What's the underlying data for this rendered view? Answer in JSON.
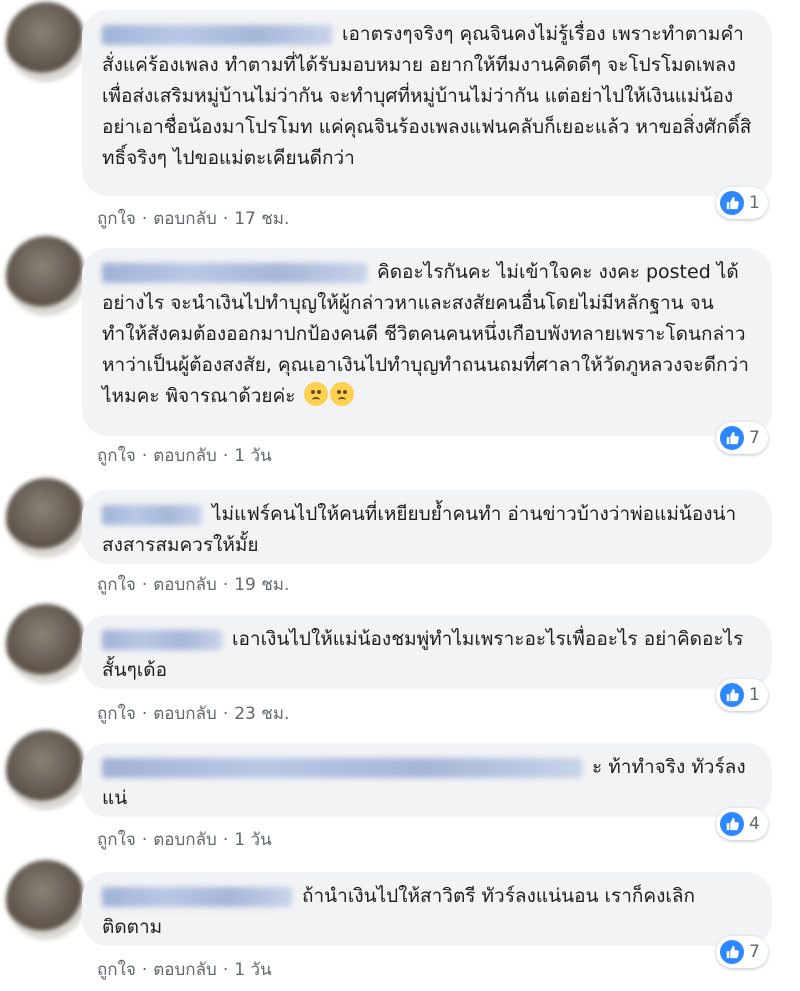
{
  "actions": {
    "like": "ถูกใจ",
    "reply": "ตอบกลับ",
    "sep": "·"
  },
  "comments": [
    {
      "text": "เอาตรงๆจริงๆ คุณจินคงไม่รู้เรื่อง เพราะทำตามคำสั่งแค่ร้องเพลง ทำตามที่ได้รับมอบหมาย อยากให้ทีมงานคิดดีๆ จะโปรโมดเพลงเพื่อส่งเสริมหมู่บ้านไม่ว่ากัน จะทำบุศที่หมู่บ้านไม่ว่ากัน แต่อย่าไปให้เงินแม่น้องอย่าเอาชื่อน้องมาโปรโมท แค่คุณจินร้องเพลงแฟนคลับก็เยอะแล้ว หาขอสิ่งศักดิ์สิทธิ์จริงๆ ไปขอแม่ตะเคียนดีกว่า",
      "time": "17 ชม.",
      "likes": "1"
    },
    {
      "text": "คิดอะไรกันคะ ไม่เข้าใจคะ งงคะ posted ได้อย่างไร จะนำเงินไปทำบุญให้ผู้กล่าวหาและสงสัยคนอื่นโดยไม่มีหลักฐาน จนทำให้สังคมต้องออกมาปกป้องคนดี ชีวิตคนคนหนึ่งเกือบพังทลายเพราะโดนกล่าวหาว่าเป็นผู้ต้องสงสัย, คุณเอาเงินไปทำบุญทำถนนถมที่ศาลาให้วัดภูหลวงจะดีกว่าไหมคะ พิจารณาด้วยค่ะ",
      "time": "1 วัน",
      "likes": "7"
    },
    {
      "text": "ไม่แฟร์คนไปให้คนที่เหยียบย้ำคนทำ อ่านข่าวบ้างว่าพ่อแม่น้องน่าสงสารสมควรให้มั้ย",
      "time": "19 ชม.",
      "likes": ""
    },
    {
      "text": "เอาเงินไปให้แม่น้องชมพู่ทำไมเพราะอะไรเพื่ออะไร อย่าคิดอะไรสั้นๆเด้อ",
      "time": "23 ชม.",
      "likes": "1"
    },
    {
      "text": "ะ ท้าทำจริง ทัวร์ลงแน่",
      "time": "1 วัน",
      "likes": "4"
    },
    {
      "text": "ถ้านำเงินไปให้สาวิตรี ทัวร์ลงแน่นอน เราก็คงเลิกติดตาม",
      "time": "1 วัน",
      "likes": "7"
    }
  ],
  "colors": {
    "bubble": "#f2f3f5",
    "like_blue": "#2d88ff",
    "meta": "#606770"
  }
}
